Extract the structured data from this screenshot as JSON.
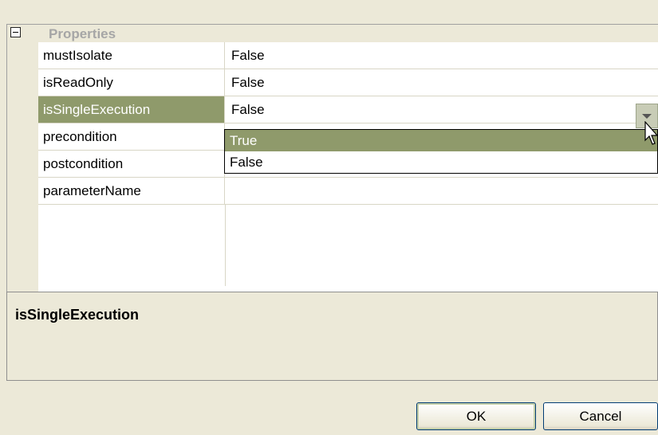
{
  "property_grid": {
    "category": {
      "label": "Properties",
      "toggle_icon": "minus-box-icon"
    },
    "rows": [
      {
        "name": "mustIsolate",
        "value": "False"
      },
      {
        "name": "isReadOnly",
        "value": "False"
      },
      {
        "name": "isSingleExecution",
        "value": "False"
      },
      {
        "name": "precondition",
        "value": ""
      },
      {
        "name": "postcondition",
        "value": ""
      },
      {
        "name": "parameterName",
        "value": ""
      }
    ],
    "selected_row": "isSingleExecution",
    "selection_color": "#8f9a6b"
  },
  "dropdown": {
    "options": [
      "True",
      "False"
    ],
    "highlighted": "True",
    "button_icon": "dropdown-arrow-icon"
  },
  "description": {
    "title": "isSingleExecution",
    "text": ""
  },
  "buttons": {
    "ok": "OK",
    "cancel": "Cancel"
  },
  "colors": {
    "background": "#ece9d8",
    "highlight": "#8f9a6b"
  }
}
